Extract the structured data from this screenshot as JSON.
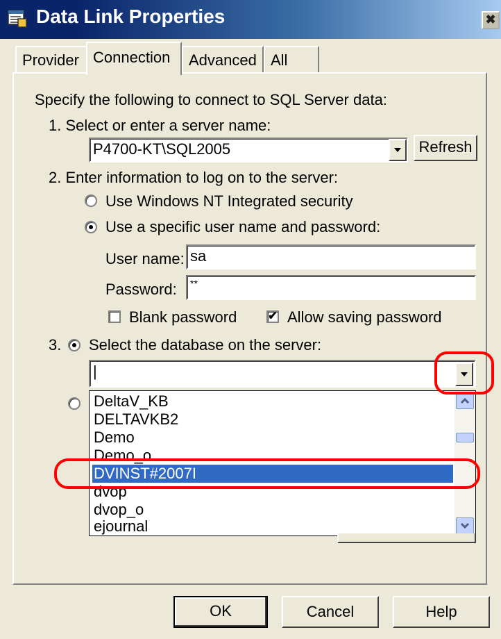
{
  "window": {
    "title": "Data Link Properties",
    "close_glyph": "✖"
  },
  "tabs": [
    {
      "label": "Provider"
    },
    {
      "label": "Connection"
    },
    {
      "label": "Advanced"
    },
    {
      "label": "All"
    }
  ],
  "connection": {
    "intro": "Specify the following to connect to SQL Server data:",
    "step1_label": "1. Select or enter a server name:",
    "server_value": "P4700-KT\\SQL2005",
    "refresh_label": "Refresh",
    "step2_label": "2. Enter information to log on to the server:",
    "radio_nt_label": "Use Windows NT Integrated security",
    "radio_specific_label": "Use a specific user name and password:",
    "username_label": "User name:",
    "username_value": "sa",
    "password_label": "Password:",
    "password_value": "**",
    "blank_password_label": "Blank password",
    "allow_saving_label": "Allow saving password",
    "step3_prefix": "3.",
    "step3_label": "Select the database on the server:",
    "database_value": "|",
    "database_options": [
      "DeltaV_KB",
      "DELTAVKB2",
      "Demo",
      "Demo_o",
      "DVINST#2007I",
      "dvop",
      "dvop_o",
      "ejournal"
    ],
    "selected_database": "DVINST#2007I",
    "checkmark_glyph": "✔"
  },
  "footer": {
    "ok_label": "OK",
    "cancel_label": "Cancel",
    "help_label": "Help"
  },
  "colors": {
    "annotation": "#ff0000",
    "selection": "#316ac5",
    "title_bar": "#0a246a"
  }
}
